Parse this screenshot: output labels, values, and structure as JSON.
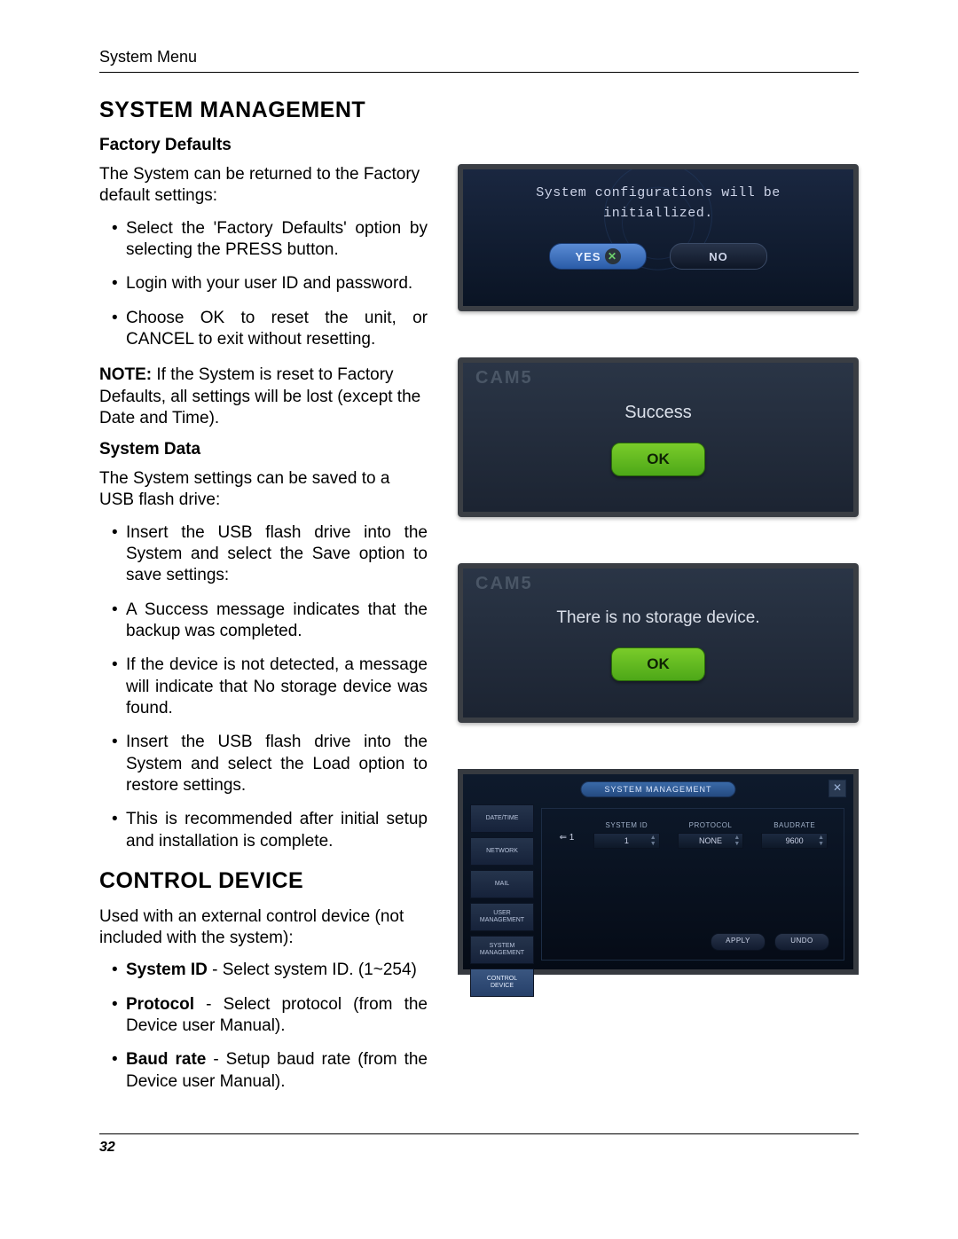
{
  "header": {
    "label": "System Menu"
  },
  "section1": {
    "title": "SYSTEM MANAGEMENT",
    "sub1_title": "Factory Defaults",
    "sub1_p1": "The System can be returned to the Factory default settings:",
    "sub1_li1": "Select the 'Factory Defaults' option by selecting the PRESS button.",
    "sub1_li2": "Login with your user ID and password.",
    "sub1_li3": "Choose OK to reset the unit, or CANCEL to exit without resetting.",
    "note_label": "NOTE:",
    "note_text": " If the System is reset to Factory Defaults, all settings will be lost (except the Date and Time).",
    "sub2_title": "System Data",
    "sub2_p1": "The System settings can be saved to a USB flash drive:",
    "sub2_li1": "Insert the USB flash drive into the System and select the Save option to save settings:",
    "sub2_li2": "A Success message indicates that the backup was completed.",
    "sub2_li3": "If the device is not detected, a message will indicate that No storage device was found.",
    "sub2_li4": "Insert the USB flash drive into the System and select the Load option to restore settings.",
    "sub2_li5": "This is recommended after initial setup and installation is complete."
  },
  "section2": {
    "title": "CONTROL DEVICE",
    "p1": "Used with an external control device (not included with the system):",
    "li1_b": "System ID",
    "li1_t": " - Select system ID. (1~254)",
    "li2_b": "Protocol",
    "li2_t": " - Select protocol (from the Device user Manual).",
    "li3_b": "Baud rate",
    "li3_t": " - Setup baud rate (from the Device user Manual)."
  },
  "shots": {
    "s1_msg_l1": "System configurations will be",
    "s1_msg_l2": "initiallized.",
    "s1_yes": "YES",
    "s1_no": "NO",
    "s2_cam": "CAM5",
    "s2_msg": "Success",
    "s2_ok": "OK",
    "s3_cam": "CAM5",
    "s3_msg": "There is no storage device.",
    "s3_ok": "OK",
    "cd_title": "SYSTEM MANAGEMENT",
    "cd_tabs": [
      "DATE/TIME",
      "NETWORK",
      "MAIL",
      "USER\nMANAGEMENT",
      "SYSTEM\nMANAGEMENT",
      "CONTROL\nDEVICE"
    ],
    "cd_h_sysid": "SYSTEM ID",
    "cd_h_proto": "PROTOCOL",
    "cd_h_baud": "BAUDRATE",
    "cd_idx": "1",
    "cd_v_sysid": "1",
    "cd_v_proto": "NONE",
    "cd_v_baud": "9600",
    "cd_apply": "APPLY",
    "cd_undo": "UNDO"
  },
  "footer": {
    "page": "32"
  }
}
